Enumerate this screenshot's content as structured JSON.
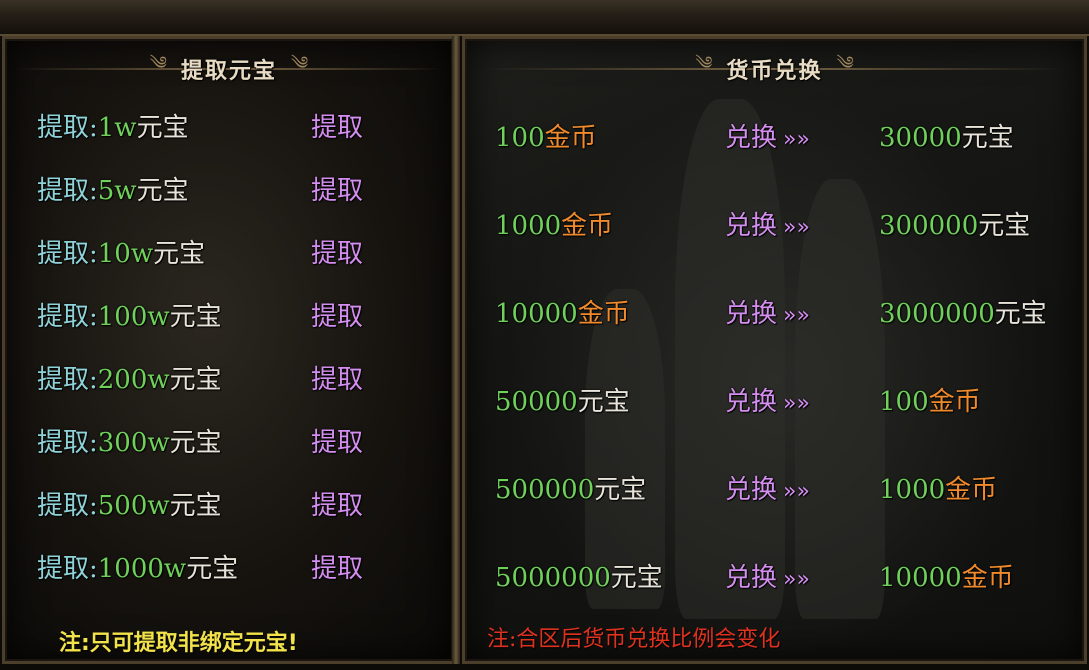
{
  "left_panel": {
    "title": "提取元宝",
    "rows": [
      {
        "prefix": "提取:",
        "amount": "1w",
        "unit": "元宝",
        "action": "提取"
      },
      {
        "prefix": "提取:",
        "amount": "5w",
        "unit": "元宝",
        "action": "提取"
      },
      {
        "prefix": "提取:",
        "amount": "10w",
        "unit": "元宝",
        "action": "提取"
      },
      {
        "prefix": "提取:",
        "amount": "100w",
        "unit": "元宝",
        "action": "提取"
      },
      {
        "prefix": "提取:",
        "amount": "200w",
        "unit": "元宝",
        "action": "提取"
      },
      {
        "prefix": "提取:",
        "amount": "300w",
        "unit": "元宝",
        "action": "提取"
      },
      {
        "prefix": "提取:",
        "amount": "500w",
        "unit": "元宝",
        "action": "提取"
      },
      {
        "prefix": "提取:",
        "amount": "1000w",
        "unit": "元宝",
        "action": "提取"
      }
    ],
    "note": "注:只可提取非绑定元宝!"
  },
  "right_panel": {
    "title": "货币兑换",
    "rows": [
      {
        "from_amount": "100",
        "from_unit": "金币",
        "action": "兑换",
        "arrow": "»»",
        "to_amount": "30000",
        "to_unit": "元宝"
      },
      {
        "from_amount": "1000",
        "from_unit": "金币",
        "action": "兑换",
        "arrow": "»»",
        "to_amount": "300000",
        "to_unit": "元宝"
      },
      {
        "from_amount": "10000",
        "from_unit": "金币",
        "action": "兑换",
        "arrow": "»»",
        "to_amount": "3000000",
        "to_unit": "元宝"
      },
      {
        "from_amount": "50000",
        "from_unit": "元宝",
        "action": "兑换",
        "arrow": "»»",
        "to_amount": "100",
        "to_unit": "金币"
      },
      {
        "from_amount": "500000",
        "from_unit": "元宝",
        "action": "兑换",
        "arrow": "»»",
        "to_amount": "1000",
        "to_unit": "金币"
      },
      {
        "from_amount": "5000000",
        "from_unit": "元宝",
        "action": "兑换",
        "arrow": "»»",
        "to_amount": "10000",
        "to_unit": "金币"
      }
    ],
    "note": "注:合区后货币兑换比例会变化"
  }
}
